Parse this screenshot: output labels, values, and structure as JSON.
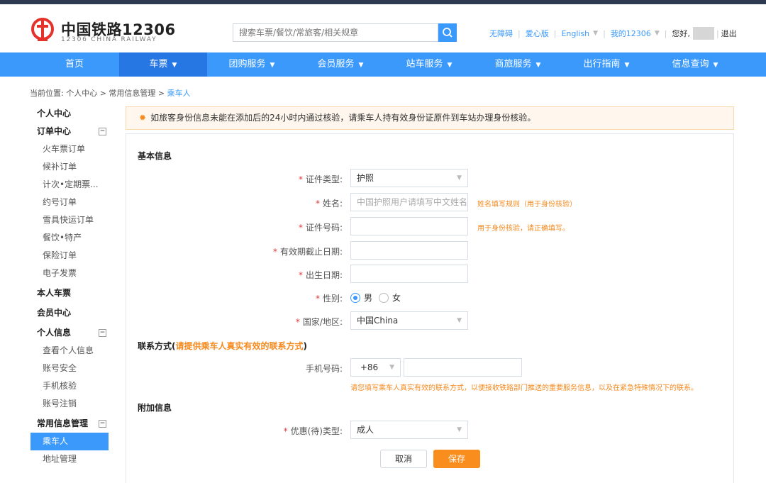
{
  "brand": {
    "cn": "中国铁路12306",
    "en": "12306 CHINA RAILWAY"
  },
  "search": {
    "placeholder": "搜索车票/餐饮/常旅客/相关规章"
  },
  "toplinks": {
    "accessible": "无障碍",
    "love": "爱心版",
    "english": "English",
    "my12306": "我的12306",
    "hello": "您好,",
    "logout": "退出"
  },
  "nav": [
    {
      "label": "首页"
    },
    {
      "label": "车票"
    },
    {
      "label": "团购服务"
    },
    {
      "label": "会员服务"
    },
    {
      "label": "站车服务"
    },
    {
      "label": "商旅服务"
    },
    {
      "label": "出行指南"
    },
    {
      "label": "信息查询"
    }
  ],
  "breadcrumb": {
    "prefix": "当前位置: 个人中心 > 常用信息管理 > ",
    "current": "乘车人"
  },
  "sidebar": {
    "personal_center": "个人中心",
    "order_center": "订单中心",
    "orders": [
      "火车票订单",
      "候补订单",
      "计次•定期票...",
      "约号订单",
      "雪具快运订单",
      "餐饮•特产",
      "保险订单",
      "电子发票"
    ],
    "my_tickets": "本人车票",
    "member_center": "会员中心",
    "personal_info": "个人信息",
    "info_items": [
      "查看个人信息",
      "账号安全",
      "手机核验",
      "账号注销"
    ],
    "common_info": "常用信息管理",
    "common_items": [
      "乘车人",
      "地址管理"
    ],
    "toggle": "−"
  },
  "notice": {
    "text": "如旅客身份信息未能在添加后的24小时内通过核验，请乘车人持有效身份证原件到车站办理身份核验。"
  },
  "form": {
    "basic_title": "基本信息",
    "req_mark": "*",
    "id_type": {
      "label": "证件类型:",
      "value": "护照"
    },
    "name": {
      "label": "姓名:",
      "placeholder": "中国护照用户请填写中文姓名",
      "hint": "姓名填写规则（用于身份核验）"
    },
    "id_number": {
      "label": "证件号码:",
      "hint": "用于身份核验，请正确填写。"
    },
    "expiry": {
      "label": "有效期截止日期:"
    },
    "birth": {
      "label": "出生日期:"
    },
    "gender": {
      "label": "性别:",
      "male": "男",
      "female": "女",
      "selected": "男"
    },
    "country": {
      "label": "国家/地区:",
      "value": "中国China"
    },
    "contact_title_a": "联系方式(",
    "contact_title_b": "请提供乘车人真实有效的联系方式",
    "contact_title_c": ")",
    "phone": {
      "label": "手机号码:",
      "code": "+86",
      "hint": "请您填写乘车人真实有效的联系方式，以便接收铁路部门推送的重要服务信息，以及在紧急特殊情况下的联系。"
    },
    "extra_title": "附加信息",
    "discount": {
      "label": "优惠(待)类型:",
      "value": "成人"
    },
    "cancel_label": "取消",
    "save_label": "保存"
  },
  "colors": {
    "brand_blue": "#3b99fc",
    "active_nav": "#2676e3",
    "orange": "#f98e1e",
    "logo_red": "#e5322d"
  }
}
